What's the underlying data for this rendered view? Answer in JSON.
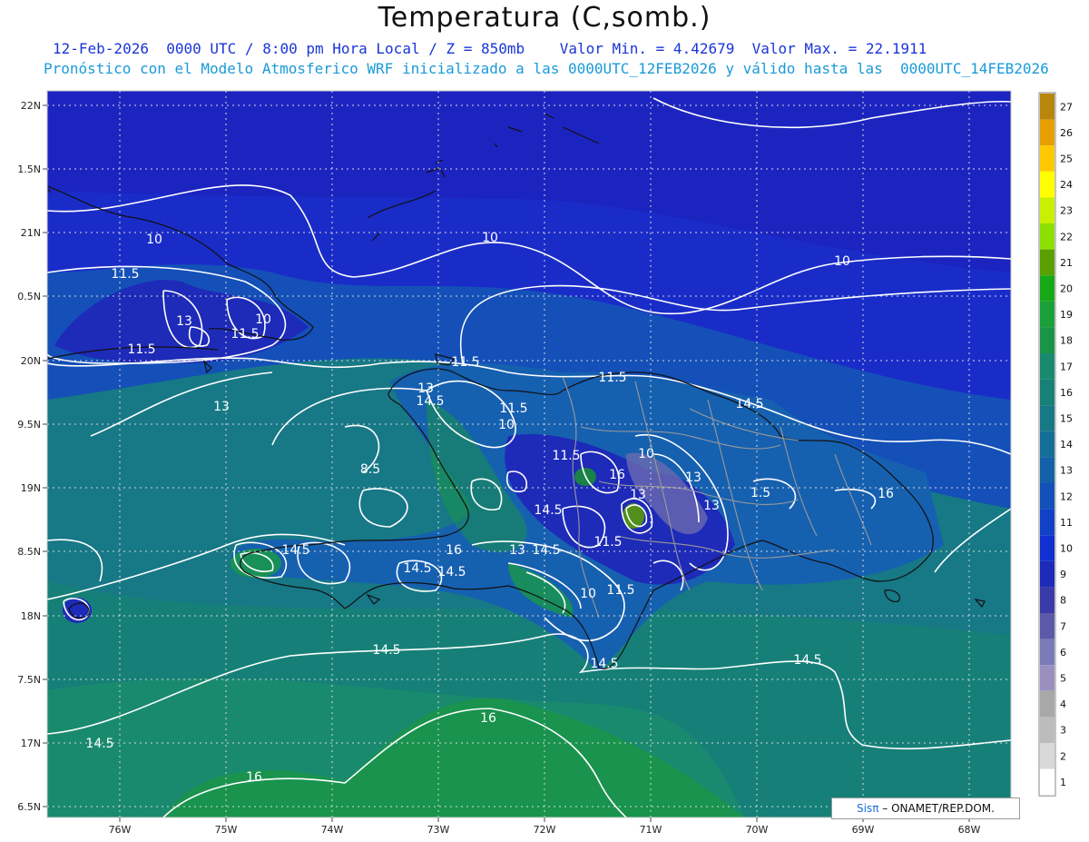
{
  "header": {
    "title": "Temperatura (C,somb.)",
    "line1": "12-Feb-2026  0000 UTC / 8:00 pm Hora Local / Z = 850mb    Valor Min. = 4.42679  Valor Max. = 22.1911",
    "line2": "Pronóstico con el Modelo Atmosferico WRF inicializado a las 0000UTC_12FEB2026 y válido hasta las  0000UTC_14FEB2026"
  },
  "map": {
    "x_ticks": [
      "76W",
      "75W",
      "74W",
      "73W",
      "72W",
      "71W",
      "70W",
      "69W",
      "68W"
    ],
    "y_ticks": [
      "22N",
      "1.5N",
      "21N",
      "0.5N",
      "20N",
      "9.5N",
      "19N",
      "8.5N",
      "18N",
      "7.5N",
      "17N",
      "6.5N"
    ],
    "contour_labels": [
      {
        "text": "10"
      },
      {
        "text": "10"
      },
      {
        "text": "10"
      },
      {
        "text": "11.5"
      },
      {
        "text": "13"
      },
      {
        "text": "10"
      },
      {
        "text": "11.5"
      },
      {
        "text": "11.5"
      },
      {
        "text": "13"
      },
      {
        "text": "11.5"
      },
      {
        "text": "13"
      },
      {
        "text": "14.5"
      },
      {
        "text": "11.5"
      },
      {
        "text": "10"
      },
      {
        "text": "11.5"
      },
      {
        "text": "14.5"
      },
      {
        "text": "8.5"
      },
      {
        "text": "11.5"
      },
      {
        "text": "10"
      },
      {
        "text": "16"
      },
      {
        "text": "13"
      },
      {
        "text": "13"
      },
      {
        "text": "1.5"
      },
      {
        "text": "13"
      },
      {
        "text": "16"
      },
      {
        "text": "14.5"
      },
      {
        "text": "14.5"
      },
      {
        "text": "16"
      },
      {
        "text": "13"
      },
      {
        "text": "14.5"
      },
      {
        "text": "11.5"
      },
      {
        "text": "14.5"
      },
      {
        "text": "14.5"
      },
      {
        "text": "10"
      },
      {
        "text": "11.5"
      },
      {
        "text": "14.5"
      },
      {
        "text": "14.5"
      },
      {
        "text": "14.5"
      },
      {
        "text": "14.5"
      },
      {
        "text": "16"
      },
      {
        "text": "16"
      }
    ],
    "colors": {
      "deep": "#1a2cc8",
      "mid": "#1550c0",
      "teal": "#157a9a",
      "seaGreen": "#1a8a6e",
      "green": "#1a9448",
      "contour": "#ffffff"
    }
  },
  "legend": {
    "levels": [
      "27",
      "26",
      "25",
      "24",
      "23",
      "22",
      "21",
      "20",
      "19",
      "18",
      "17",
      "16",
      "15",
      "14",
      "13",
      "12",
      "11",
      "10",
      "9",
      "8",
      "7",
      "6",
      "5",
      "4",
      "3",
      "2",
      "1"
    ],
    "colors": [
      "#b8860b",
      "#e6a000",
      "#ffc800",
      "#ffff00",
      "#c8f000",
      "#8ce000",
      "#5aa000",
      "#17a817",
      "#1aa03a",
      "#1a9448",
      "#1a8a6e",
      "#188076",
      "#177886",
      "#156e96",
      "#1460a8",
      "#1350b8",
      "#1240c8",
      "#1030d0",
      "#1e2ab8",
      "#3a3aa8",
      "#5a5aa8",
      "#7a7ab8",
      "#9a90c0",
      "#a8a8a8",
      "#bcbcbc",
      "#d8d8d8",
      "#ffffff"
    ]
  },
  "credit": {
    "brand": "Sisπ",
    "text": " – ONAMET/REP.DOM."
  }
}
